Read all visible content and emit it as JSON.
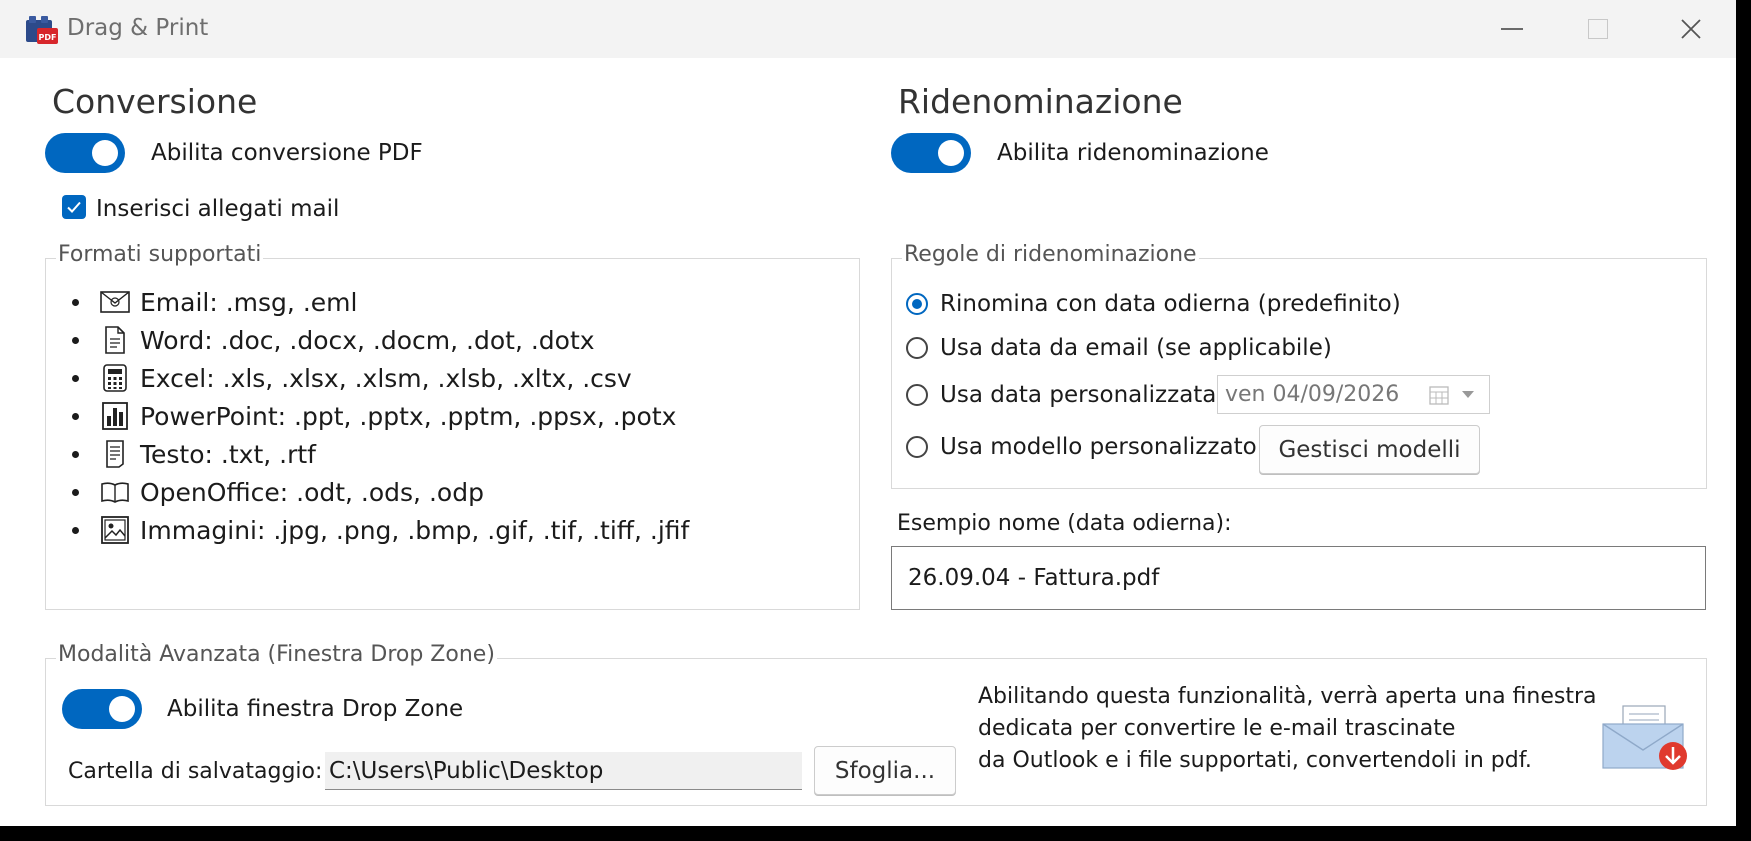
{
  "window": {
    "title": "Drag & Print",
    "app_icon_badge": "PDF"
  },
  "conversion": {
    "heading": "Conversione",
    "toggle_label": "Abilita conversione PDF",
    "toggle_on": true,
    "attach_checkbox_label": "Inserisci allegati mail",
    "attach_checked": true,
    "formats_legend": "Formati supportati",
    "formats": [
      {
        "icon": "email-icon",
        "text": "Email: .msg, .eml"
      },
      {
        "icon": "word-document-icon",
        "text": "Word: .doc, .docx, .docm, .dot, .dotx"
      },
      {
        "icon": "calculator-icon",
        "text": "Excel: .xls, .xlsx, .xlsm, .xlsb, .xltx, .csv"
      },
      {
        "icon": "bar-chart-icon",
        "text": "PowerPoint: .ppt, .pptx, .pptm, .ppsx, .potx"
      },
      {
        "icon": "text-file-icon",
        "text": "Testo: .txt, .rtf"
      },
      {
        "icon": "open-book-icon",
        "text": "OpenOffice: .odt, .ods, .odp"
      },
      {
        "icon": "image-icon",
        "text": "Immagini: .jpg, .png, .bmp, .gif, .tif, .tiff, .jfif"
      }
    ]
  },
  "rename": {
    "heading": "Ridenominazione",
    "toggle_label": "Abilita ridenominazione",
    "toggle_on": true,
    "rules_legend": "Regole di ridenominazione",
    "options": [
      {
        "label": "Rinomina con data odierna (predefinito)",
        "selected": true
      },
      {
        "label": "Usa data da email (se applicabile)",
        "selected": false
      },
      {
        "label": "Usa data personalizzata",
        "selected": false
      },
      {
        "label": "Usa modello personalizzato",
        "selected": false
      }
    ],
    "date_picker_value": "ven  04/09/2026",
    "manage_models_button": "Gestisci modelli",
    "example_label": "Esempio nome (data odierna):",
    "example_value": "26.09.04 - Fattura.pdf"
  },
  "advanced": {
    "legend": "Modalità Avanzata (Finestra Drop Zone)",
    "toggle_label": "Abilita finestra Drop Zone",
    "toggle_on": true,
    "save_folder_label": "Cartella di salvataggio:",
    "save_folder_value": "C:\\Users\\Public\\Desktop",
    "browse_button": "Sfoglia...",
    "description_lines": [
      "Abilitando questa funzionalità, verrà aperta una finestra",
      "dedicata per convertire le e-mail trascinate",
      "da Outlook e i file supportati, convertendoli in pdf."
    ]
  },
  "colors": {
    "accent": "#0067c0",
    "titlebar": "#f3f3f3",
    "download_badge": "#e03a2e"
  }
}
